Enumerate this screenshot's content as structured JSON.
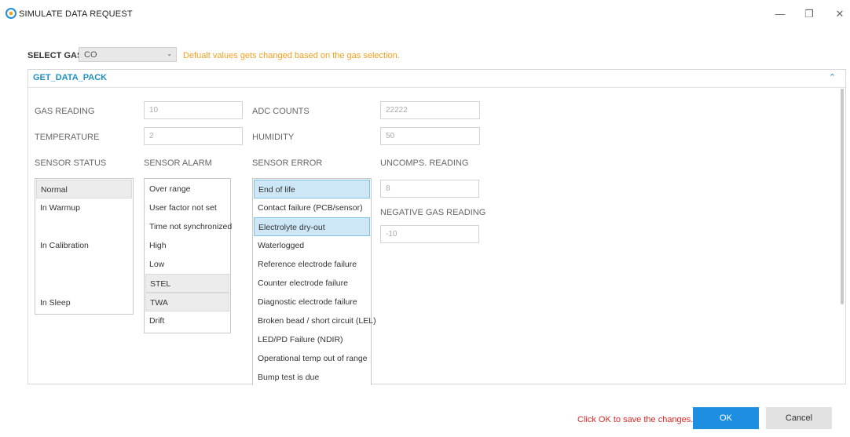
{
  "window": {
    "title": "SIMULATE DATA REQUEST",
    "minimize_glyph": "—",
    "restore_glyph": "❐",
    "close_glyph": "✕"
  },
  "gas_select": {
    "label": "SELECT GAS",
    "value": "CO",
    "note": "Defualt values gets changed based on the gas selection."
  },
  "panel": {
    "title": "GET_DATA_PACK",
    "fields": {
      "gas_reading": {
        "label": "GAS READING",
        "value": "10"
      },
      "adc_counts": {
        "label": "ADC COUNTS",
        "value": "22222"
      },
      "temperature": {
        "label": "TEMPERATURE",
        "value": "2"
      },
      "humidity": {
        "label": "HUMIDITY",
        "value": "50"
      },
      "uncomps_reading": {
        "label": "UNCOMPS. READING",
        "value": "8"
      },
      "negative_gas_reading": {
        "label": "NEGATIVE GAS READING",
        "value": "-10"
      }
    },
    "sensor_status": {
      "label": "SENSOR STATUS",
      "items": [
        "Normal",
        "In Warmup",
        "In Calibration",
        "In Sleep"
      ]
    },
    "sensor_alarm": {
      "label": "SENSOR ALARM",
      "items": [
        "Over range",
        "User factor not set",
        "Time not synchronized",
        "High",
        "Low",
        "STEL",
        "TWA",
        "Drift"
      ]
    },
    "sensor_error": {
      "label": "SENSOR ERROR",
      "items": [
        "End of life",
        "Contact failure (PCB/sensor)",
        "Electrolyte dry-out",
        "Waterlogged",
        "Reference electrode failure",
        "Counter electrode failure",
        "Diagnostic electrode failure",
        "Broken bead / short circuit (LEL)",
        "LED/PD Failure (NDIR)",
        "Operational temp out of range",
        "Bump test is due"
      ]
    }
  },
  "footer": {
    "note": "Click OK to save the changes.",
    "ok_label": "OK",
    "cancel_label": "Cancel"
  },
  "colors": {
    "accent": "#1e8fe0",
    "note_orange": "#f0a020",
    "warning_red": "#d92b2b",
    "selected_blue": "#cde7f7",
    "selected_grey": "#ececec"
  }
}
